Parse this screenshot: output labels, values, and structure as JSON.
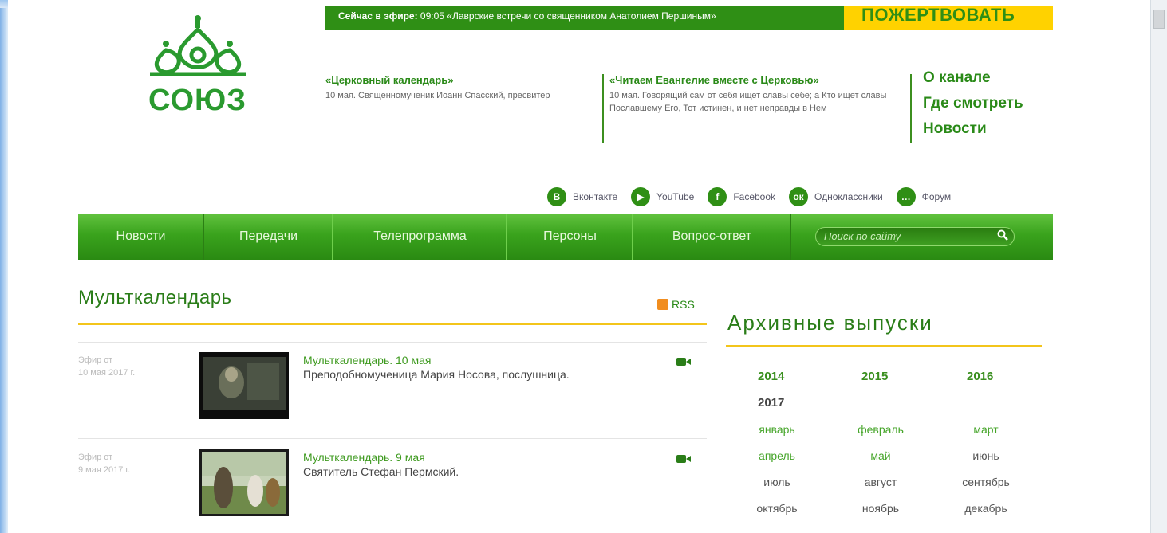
{
  "header": {
    "onair_label": "Сейчас в эфире:",
    "onair_text": " 09:05 «Лаврские встречи со священником Анатолием Першиным»",
    "donate_label": "ПОЖЕРТВОВАТЬ",
    "logo_text": "СОЮЗ"
  },
  "calendars": [
    {
      "title": "«Церковный календарь»",
      "text": "10 мая. Священномученик Иоанн Спасский, пресвитер"
    },
    {
      "title": "«Читаем Евангелие вместе с Церковью»",
      "text": "10 мая. Говорящий сам от себя ищет славы себе; а Кто ищет славы Пославшему Его, Тот истинен, и нет неправды в Нем"
    }
  ],
  "top_links": [
    "О канале",
    "Где смотреть",
    "Новости"
  ],
  "social": [
    {
      "label": "Вконтакте",
      "icon": "vk-icon",
      "glyph": "B"
    },
    {
      "label": "YouTube",
      "icon": "youtube-icon",
      "glyph": "▶"
    },
    {
      "label": "Facebook",
      "icon": "facebook-icon",
      "glyph": "f"
    },
    {
      "label": "Одноклассники",
      "icon": "odnoklassniki-icon",
      "glyph": "ок"
    },
    {
      "label": "Форум",
      "icon": "forum-icon",
      "glyph": "…"
    }
  ],
  "nav": {
    "items": [
      "Новости",
      "Передачи",
      "Телепрограмма",
      "Персоны",
      "Вопрос-ответ"
    ],
    "search_placeholder": "Поиск по сайту"
  },
  "main": {
    "title": "Мульткалендарь",
    "rss_label": "RSS",
    "entries": [
      {
        "date_line1": "Эфир от",
        "date_line2": "10 мая 2017 г.",
        "title": "Мульткалендарь. 10 мая",
        "desc": "Преподобномученица Мария Носова, послушница."
      },
      {
        "date_line1": "Эфир от",
        "date_line2": "9 мая 2017 г.",
        "title": "Мульткалендарь. 9 мая",
        "desc": "Святитель Стефан Пермский."
      }
    ]
  },
  "archive": {
    "title": "Архивные выпуски",
    "years": [
      "2014",
      "2015",
      "2016",
      "2017"
    ],
    "months": [
      "январь",
      "февраль",
      "март",
      "апрель",
      "май",
      "июнь",
      "июль",
      "август",
      "сентябрь",
      "октябрь",
      "ноябрь",
      "декабрь"
    ]
  },
  "colors": {
    "brand_green": "#2f8f15",
    "accent_yellow": "#ffd200",
    "gold_line": "#f3c51b"
  }
}
